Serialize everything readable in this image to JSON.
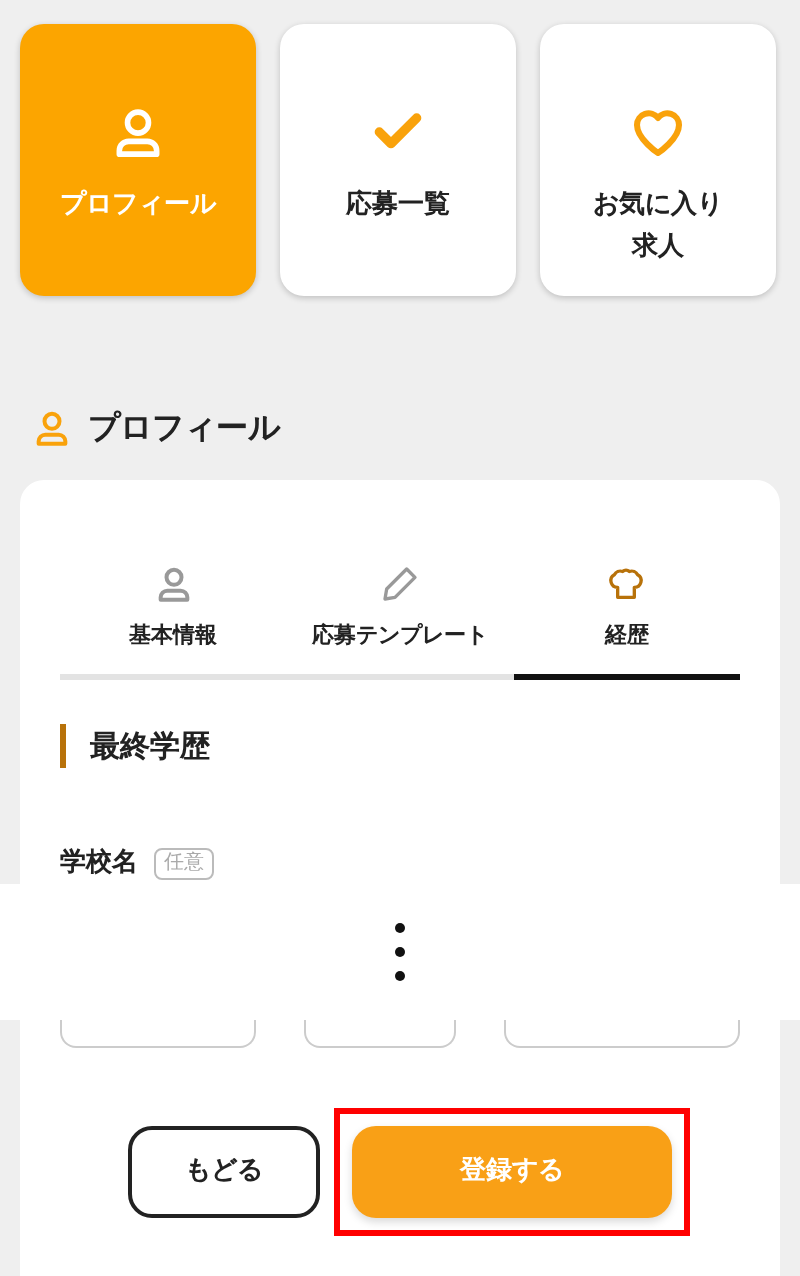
{
  "nav_tiles": [
    {
      "kind": "person",
      "lines": [
        "プロフィール"
      ],
      "selected": true
    },
    {
      "kind": "check",
      "lines": [
        "応募一覧"
      ],
      "selected": false
    },
    {
      "kind": "heart",
      "lines": [
        "お気に入り",
        "求人"
      ],
      "selected": false
    }
  ],
  "section_title": "プロフィール",
  "tabs": [
    {
      "kind": "person",
      "label": "基本情報",
      "selected": false
    },
    {
      "kind": "pencil",
      "label": "応募テンプレート",
      "selected": false
    },
    {
      "kind": "chef",
      "label": "経歴",
      "selected": true
    }
  ],
  "subsection": "最終学歴",
  "field_label": "学校名",
  "field_badge": "任意",
  "buttons": [
    {
      "kind": "back",
      "label": "もどる",
      "highlighted": false
    },
    {
      "kind": "submit",
      "label": "登録する",
      "highlighted": true
    }
  ]
}
